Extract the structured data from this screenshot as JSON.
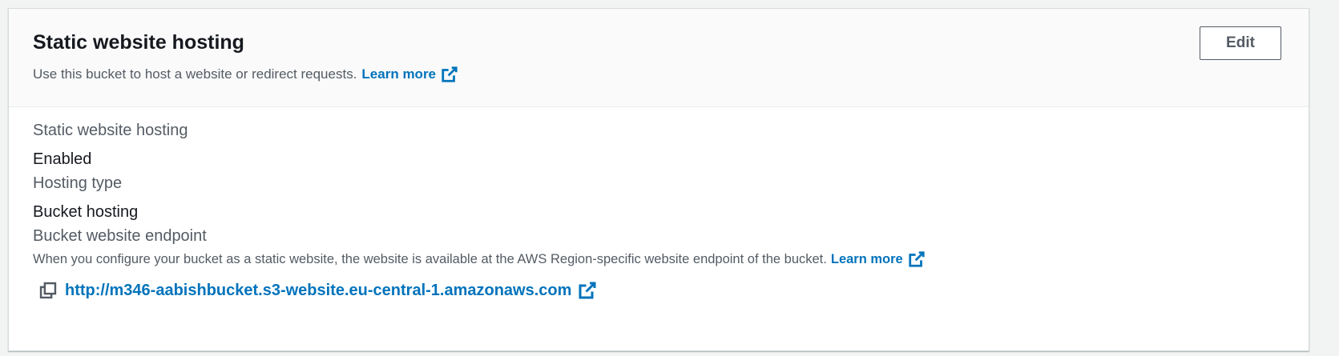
{
  "section": {
    "title": "Static website hosting",
    "description": "Use this bucket to host a website or redirect requests.",
    "learn_more": "Learn more",
    "edit_label": "Edit"
  },
  "properties": {
    "hosting_label": "Static website hosting",
    "hosting_value": "Enabled",
    "type_label": "Hosting type",
    "type_value": "Bucket hosting",
    "endpoint_label": "Bucket website endpoint",
    "endpoint_description": "When you configure your bucket as a static website, the website is available at the AWS Region-specific website endpoint of the bucket.",
    "endpoint_learn_more": "Learn more",
    "endpoint_url": "http://m346-aabishbucket.s3-website.eu-central-1.amazonaws.com"
  },
  "icons": {
    "external": "external-link-icon",
    "copy": "copy-icon"
  },
  "colors": {
    "link": "#0073bb",
    "text_primary": "#16191f",
    "text_secondary": "#545b64"
  }
}
